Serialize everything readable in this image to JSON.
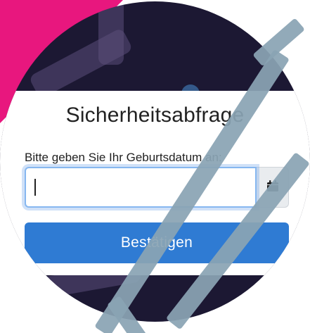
{
  "dialog": {
    "title": "Sicherheitsabfrage",
    "prompt_label": "Bitte geben Sie Ihr Geburtsdatum an:",
    "date_input_value": "",
    "calendar_icon": "calendar-icon",
    "submit_label": "Bestätigen"
  },
  "colors": {
    "accent": "#e8177e",
    "background": "#1c1833",
    "button": "#2f7bd3",
    "focus_border": "#86b7f0",
    "watermark": "#8aa4b4"
  }
}
